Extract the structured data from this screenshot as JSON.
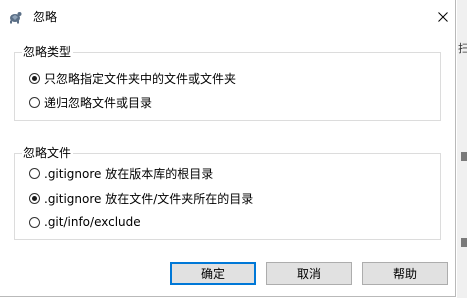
{
  "window": {
    "title": "忽略",
    "icons": {
      "app": "tortoise-app-icon",
      "close": "close-icon"
    }
  },
  "ignore_type": {
    "label": "忽略类型",
    "options": [
      {
        "label": "只忽略指定文件夹中的文件或文件夹",
        "checked": true
      },
      {
        "label": "递归忽略文件或目录",
        "checked": false
      }
    ]
  },
  "ignore_file": {
    "label": "忽略文件",
    "options": [
      {
        "label": ".gitignore 放在版本库的根目录",
        "checked": false
      },
      {
        "label": ".gitignore 放在文件/文件夹所在的目录",
        "checked": true
      },
      {
        "label": ".git/info/exclude",
        "checked": false
      }
    ]
  },
  "buttons": {
    "ok": "确定",
    "cancel": "取消",
    "help": "帮助"
  },
  "background": {
    "partial_glyph": "扫"
  }
}
